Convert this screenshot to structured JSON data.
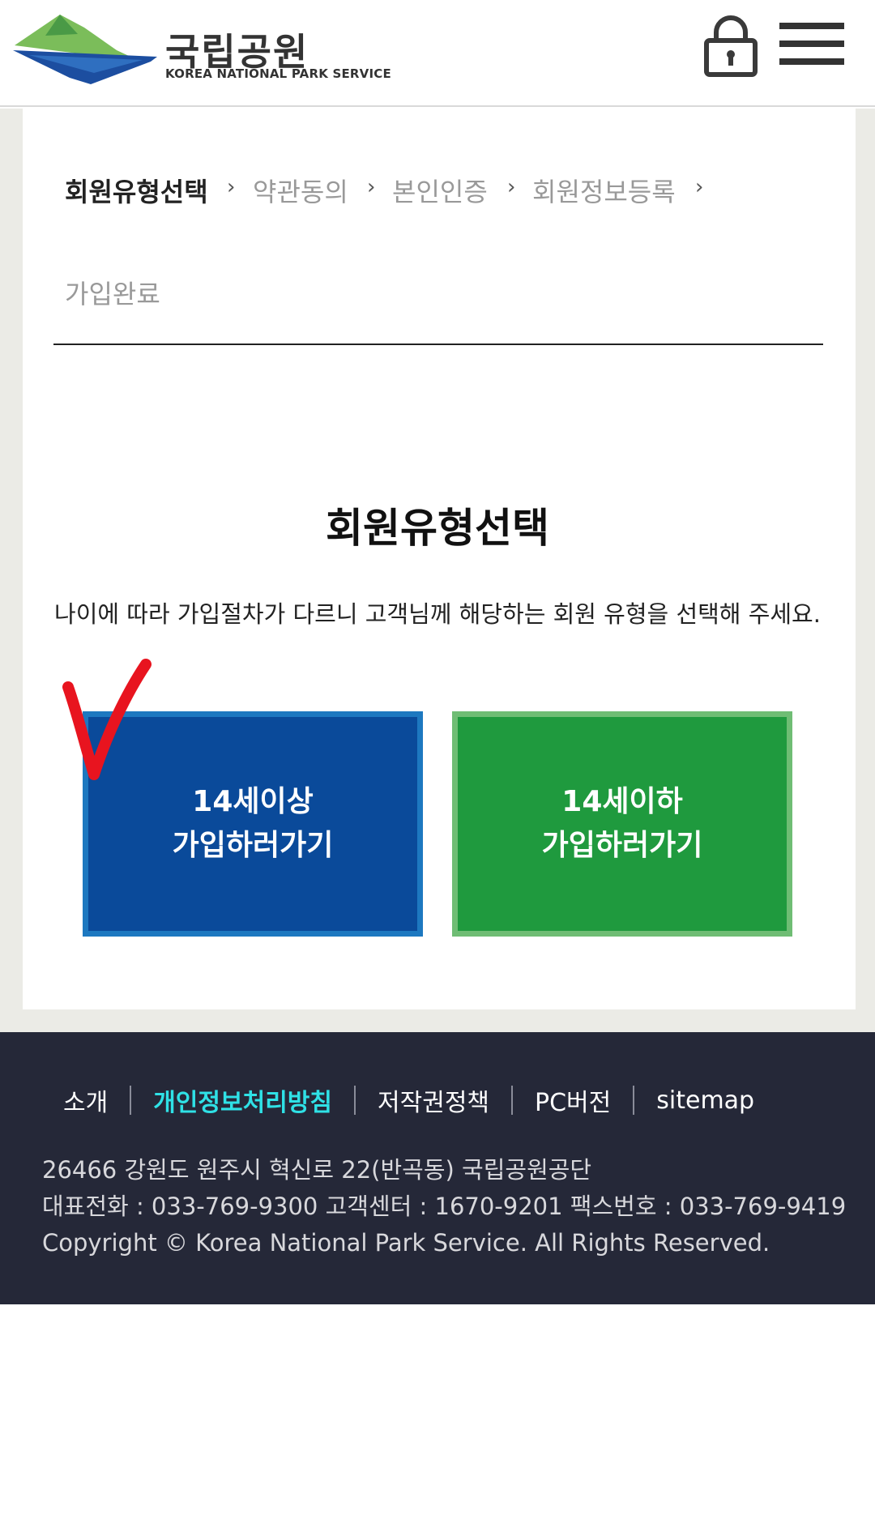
{
  "header": {
    "logo_title": "국립공원",
    "logo_subtitle": "KOREA NATIONAL PARK SERVICE",
    "lock_icon": "lock-icon",
    "menu_icon": "hamburger-menu-icon"
  },
  "steps": {
    "items": [
      "회원유형선택",
      "약관동의",
      "본인인증",
      "회원정보등록",
      "가입완료"
    ],
    "active_index": 0
  },
  "main": {
    "title": "회원유형선택",
    "description": "나이에 따라 가입절차가 다르니 고객님께 해당하는 회원 유형을 선택해 주세요.",
    "over14": {
      "line1": "14세이상",
      "line2": "가입하러가기"
    },
    "under14": {
      "line1": "14세이하",
      "line2": "가입하러가기"
    }
  },
  "footer": {
    "links": [
      "소개",
      "개인정보처리방침",
      "저작권정책",
      "PC버전",
      "sitemap"
    ],
    "address": "26466 강원도 원주시 혁신로 22(반곡동) 국립공원공단",
    "phones": "대표전화 : 033-769-9300 고객센터 : 1670-9201 팩스번호 : 033-769-9419",
    "copyright": "Copyright © Korea National Park Service. All Rights Reserved."
  },
  "colors": {
    "primary_blue": "#0a4a9a",
    "primary_green": "#1f9a3e",
    "footer_bg": "#252838",
    "highlight_link": "#2fe1e6",
    "annotation_red": "#e8141f"
  }
}
